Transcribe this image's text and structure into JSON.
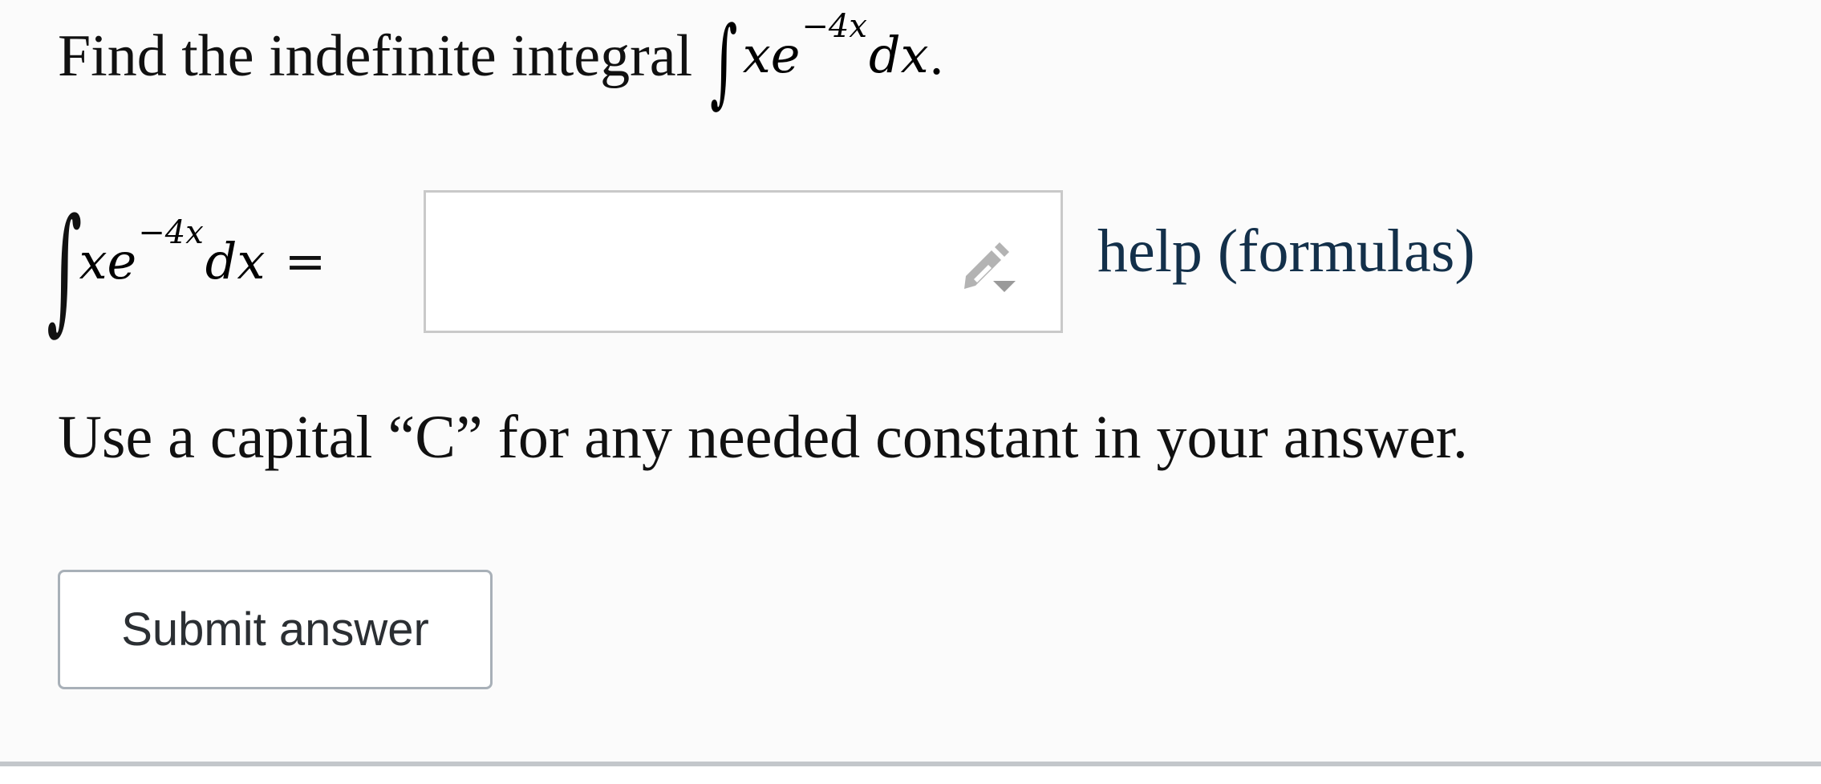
{
  "question": {
    "prompt": "Find the indefinite integral",
    "integral_symbol": "∫",
    "integrand_base": "xe",
    "integrand_exponent": "−4x",
    "differential": "dx",
    "period": "."
  },
  "answer_row": {
    "integral_symbol": "∫",
    "integrand_base": "xe",
    "integrand_exponent": "−4x",
    "differential": "dx",
    "equals": "=",
    "input_value": "",
    "input_icon": "pencil-dropdown-icon",
    "help_link": "help (formulas)"
  },
  "instruction": "Use a capital “C” for any needed constant in your answer.",
  "submit_label": "Submit answer"
}
